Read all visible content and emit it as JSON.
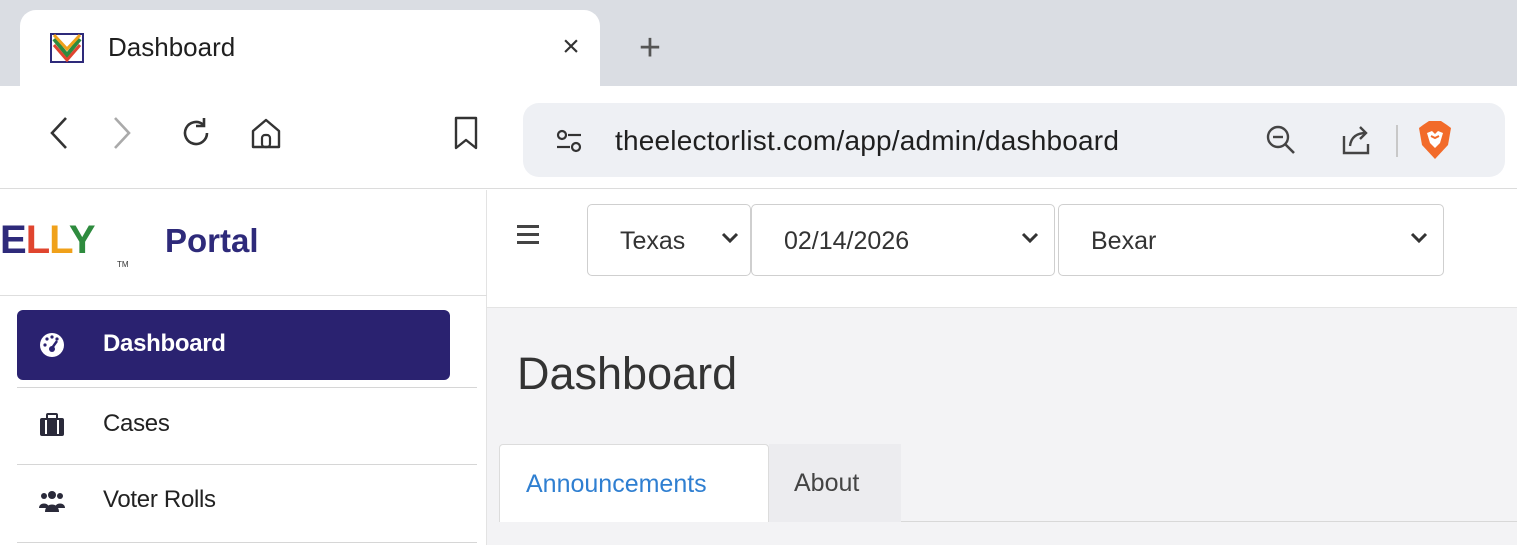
{
  "browser": {
    "tab_title": "Dashboard",
    "tab_close": "×",
    "new_tab": "+",
    "url": "theelectorlist.com/app/admin/dashboard"
  },
  "brand": {
    "logo_letters": [
      "E",
      "L",
      "L",
      "Y"
    ],
    "tm": "TM",
    "name": "Portal",
    "colors": {
      "e": "#2e2a7a",
      "l1": "#e0452f",
      "l2": "#f0a11a",
      "y": "#2e8b3e"
    }
  },
  "sidebar": {
    "items": [
      {
        "label": "Dashboard",
        "icon": "dashboard-gauge-icon",
        "active": true
      },
      {
        "label": "Cases",
        "icon": "briefcase-icon",
        "active": false
      },
      {
        "label": "Voter Rolls",
        "icon": "users-group-icon",
        "active": false
      }
    ],
    "active_color": "#2a2270"
  },
  "filters": {
    "state": "Texas",
    "date": "02/14/2026",
    "county": "Bexar"
  },
  "main": {
    "title": "Dashboard",
    "tabs": [
      {
        "label": "Announcements",
        "active": true
      },
      {
        "label": "About",
        "active": false
      }
    ],
    "tab_active_color": "#2f7fd1"
  }
}
